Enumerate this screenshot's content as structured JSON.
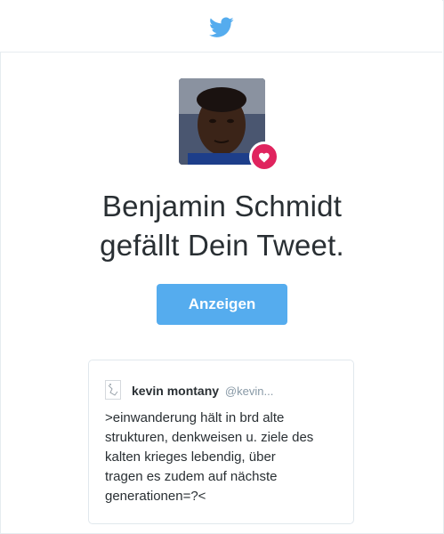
{
  "header": {
    "logo_icon": "twitter-bird-icon",
    "brand_color": "#55acee"
  },
  "notification": {
    "avatar_icon": "profile-photo",
    "badge_icon": "heart-icon",
    "badge_color": "#e0245e",
    "headline_line1": "Benjamin Schmidt",
    "headline_line2": "gefällt Dein Tweet.",
    "view_button_label": "Anzeigen"
  },
  "tweet": {
    "author_name": "kevin montany",
    "author_handle": "@kevin...",
    "text_lines": [
      ">einwanderung hält in brd alte",
      "strukturen, denkweisen u. ziele des",
      "kalten krieges lebendig, über",
      "tragen es zudem auf nächste",
      "generationen=?<"
    ]
  }
}
